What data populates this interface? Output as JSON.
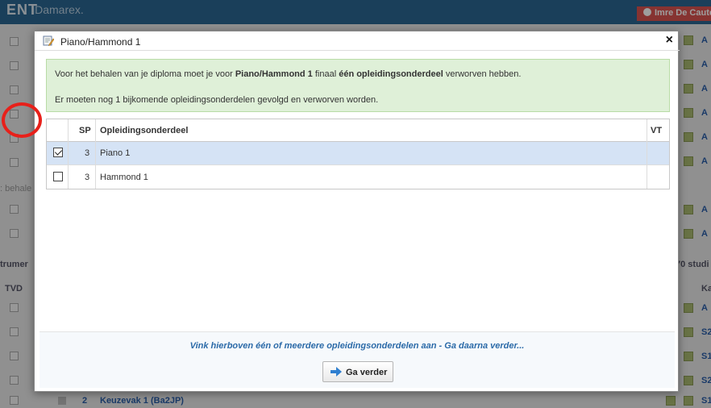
{
  "background": {
    "app_title": "ENT",
    "app_subtitle": "iDamarex.",
    "user_name": "Imre De Caute",
    "left_labels": [
      ": behale",
      "trumer",
      "TVD"
    ],
    "right_labels": [
      "A",
      "A",
      "A",
      "A",
      "A",
      "A",
      "A",
      "A",
      "Ka",
      "A",
      "S2",
      "S1",
      "S2",
      "S1"
    ],
    "right_header": "70 studi",
    "footer_row": {
      "number": "2",
      "label": "Keuzevak 1 (Ba2JP)"
    }
  },
  "dialog": {
    "title": "Piano/Hammond 1",
    "close_label": "×",
    "alert": {
      "line1_pre": "Voor het behalen van je diploma moet je voor ",
      "line1_bold1": "Piano/Hammond 1",
      "line1_mid": " finaal ",
      "line1_bold2": "één opleidingsonderdeel",
      "line1_post": " verworven hebben.",
      "line2": "Er moeten nog 1 bijkomende opleidingsonderdelen gevolgd en verworven worden."
    },
    "table": {
      "headers": {
        "sp": "SP",
        "name": "Opleidingsonderdeel",
        "vt": "VT"
      },
      "rows": [
        {
          "checked": true,
          "sp": "3",
          "name": "Piano 1",
          "vt": ""
        },
        {
          "checked": false,
          "sp": "3",
          "name": "Hammond 1",
          "vt": ""
        }
      ]
    },
    "footer_hint": "Vink hierboven één of meerdere opleidingsonderdelen aan - Ga daarna verder...",
    "continue_label": "Ga verder"
  },
  "colors": {
    "header_blue": "#2b6691",
    "alert_green": "#dff0d8",
    "selected_row": "#d5e3f5",
    "annotation_red": "#e8201a",
    "hint_blue": "#2b6aa8"
  }
}
